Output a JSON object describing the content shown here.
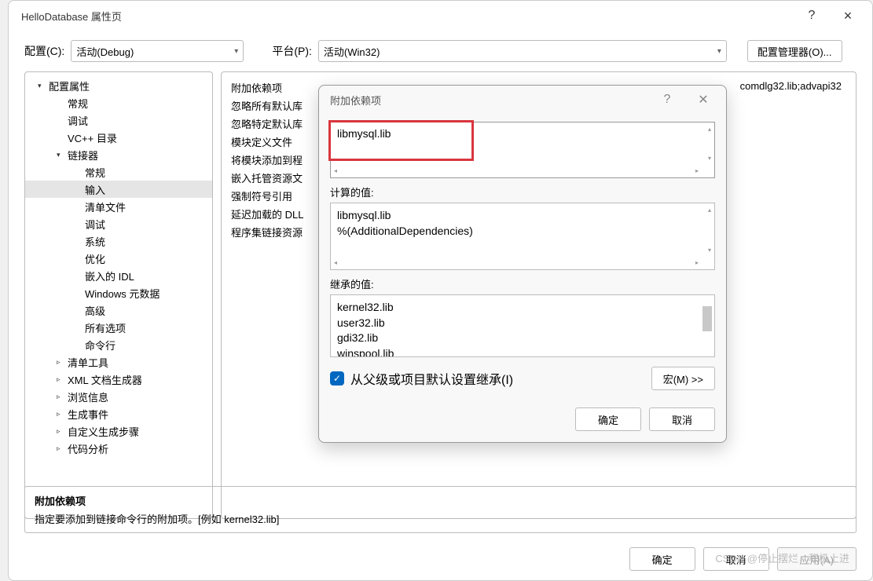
{
  "window": {
    "title": "HelloDatabase 属性页",
    "help": "?",
    "close": "×"
  },
  "config_row": {
    "config_label": "配置(C):",
    "config_value": "活动(Debug)",
    "platform_label": "平台(P):",
    "platform_value": "活动(Win32)",
    "manager_btn": "配置管理器(O)..."
  },
  "tree": [
    {
      "label": "配置属性",
      "level": 1,
      "arrow": "▾"
    },
    {
      "label": "常规",
      "level": 2
    },
    {
      "label": "调试",
      "level": 2
    },
    {
      "label": "VC++ 目录",
      "level": 2
    },
    {
      "label": "链接器",
      "level": 2,
      "arrow": "▾"
    },
    {
      "label": "常规",
      "level": 3
    },
    {
      "label": "输入",
      "level": 3,
      "selected": true
    },
    {
      "label": "清单文件",
      "level": 3
    },
    {
      "label": "调试",
      "level": 3
    },
    {
      "label": "系统",
      "level": 3
    },
    {
      "label": "优化",
      "level": 3
    },
    {
      "label": "嵌入的 IDL",
      "level": 3
    },
    {
      "label": "Windows 元数据",
      "level": 3
    },
    {
      "label": "高级",
      "level": 3
    },
    {
      "label": "所有选项",
      "level": 3
    },
    {
      "label": "命令行",
      "level": 3
    },
    {
      "label": "清单工具",
      "level": 2,
      "arrow": "▹"
    },
    {
      "label": "XML 文档生成器",
      "level": 2,
      "arrow": "▹"
    },
    {
      "label": "浏览信息",
      "level": 2,
      "arrow": "▹"
    },
    {
      "label": "生成事件",
      "level": 2,
      "arrow": "▹"
    },
    {
      "label": "自定义生成步骤",
      "level": 2,
      "arrow": "▹"
    },
    {
      "label": "代码分析",
      "level": 2,
      "arrow": "▹"
    }
  ],
  "properties": [
    {
      "label": "附加依赖项",
      "value": "comdlg32.lib;advapi32"
    },
    {
      "label": "忽略所有默认库"
    },
    {
      "label": "忽略特定默认库"
    },
    {
      "label": "模块定义文件"
    },
    {
      "label": "将模块添加到程"
    },
    {
      "label": "嵌入托管资源文"
    },
    {
      "label": "强制符号引用"
    },
    {
      "label": "延迟加载的 DLL"
    },
    {
      "label": "程序集链接资源"
    }
  ],
  "description": {
    "title": "附加依赖项",
    "text": "指定要添加到链接命令行的附加项。[例如 kernel32.lib]"
  },
  "main_buttons": {
    "ok": "确定",
    "cancel": "取消",
    "apply": "应用(A)"
  },
  "dialog": {
    "title": "附加依赖项",
    "input_value": "libmysql.lib",
    "computed_label": "计算的值:",
    "computed_values": [
      "libmysql.lib",
      "%(AdditionalDependencies)"
    ],
    "inherited_label": "继承的值:",
    "inherited_values": [
      "kernel32.lib",
      "user32.lib",
      "gdi32.lib",
      "winspool.lib"
    ],
    "inherit_checkbox": "从父级或项目默认设置继承(I)",
    "macro_btn": "宏(M) >>",
    "ok": "确定",
    "cancel": "取消"
  },
  "watermark": "CSDN @停止摆烂，积极上进"
}
